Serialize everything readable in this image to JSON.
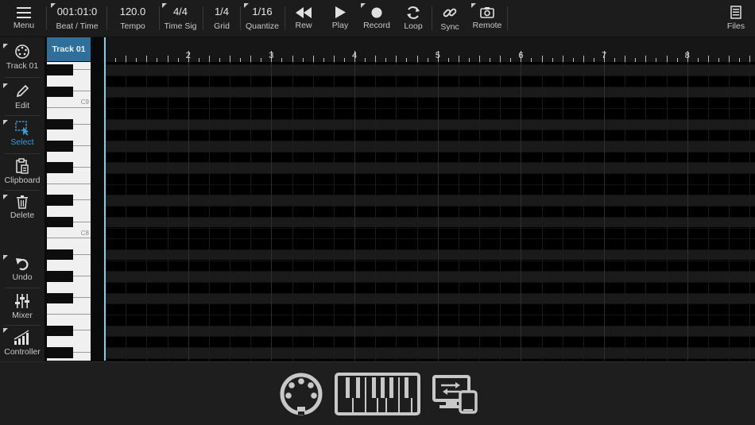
{
  "toolbar": {
    "menu": {
      "label": "Menu",
      "icon": "hamburger-icon"
    },
    "position": {
      "value": "001:01:0",
      "label": "Beat / Time"
    },
    "tempo": {
      "value": "120.0",
      "label": "Tempo"
    },
    "time_sig": {
      "value": "4/4",
      "label": "Time Sig"
    },
    "grid": {
      "value": "1/4",
      "label": "Grid"
    },
    "quantize": {
      "value": "1/16",
      "label": "Quantize"
    },
    "rew": {
      "label": "Rew",
      "icon": "rewind-icon"
    },
    "play": {
      "label": "Play",
      "icon": "play-icon"
    },
    "record": {
      "label": "Record",
      "icon": "record-icon"
    },
    "loop": {
      "label": "Loop",
      "icon": "loop-icon"
    },
    "sync": {
      "label": "Sync",
      "icon": "link-icon"
    },
    "remote": {
      "label": "Remote",
      "icon": "camera-icon"
    },
    "files": {
      "label": "Files",
      "icon": "files-icon"
    }
  },
  "sidebar": {
    "items": [
      {
        "label": "Track 01",
        "icon": "dial-icon",
        "active": false
      },
      {
        "label": "Edit",
        "icon": "pencil-icon",
        "active": false
      },
      {
        "label": "Select",
        "icon": "select-icon",
        "active": true
      },
      {
        "label": "Clipboard",
        "icon": "clipboard-icon",
        "active": false
      },
      {
        "label": "Delete",
        "icon": "trash-icon",
        "active": false
      },
      {
        "label": "Undo",
        "icon": "undo-icon",
        "active": false
      },
      {
        "label": "Mixer",
        "icon": "mixer-icon",
        "active": false
      },
      {
        "label": "Controller",
        "icon": "controller-icon",
        "active": false
      }
    ]
  },
  "track_tab": {
    "label": "Track 01"
  },
  "keyboard": {
    "octave_labels": [
      "C9",
      "C8"
    ]
  },
  "ruler": {
    "bars": [
      "2",
      "3",
      "4",
      "5",
      "6",
      "7",
      "8"
    ]
  },
  "bottom": {
    "icons": [
      "midi-port-icon",
      "piano-keyboard-icon",
      "device-sync-icon"
    ]
  },
  "colors": {
    "accent": "#3d9bd6",
    "track_tab": "#2f6f9b",
    "playhead": "#7fcdec"
  }
}
